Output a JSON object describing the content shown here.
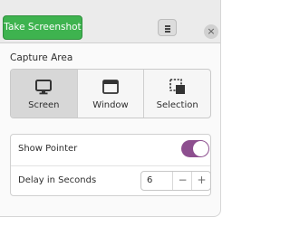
{
  "header": {
    "take_screenshot_label": "Take Screenshot",
    "menu_icon": "hamburger-menu-icon",
    "close_glyph": "×"
  },
  "capture_area": {
    "title": "Capture Area",
    "selected": "Screen",
    "options": [
      {
        "label": "Screen",
        "icon": "monitor-icon"
      },
      {
        "label": "Window",
        "icon": "window-icon"
      },
      {
        "label": "Selection",
        "icon": "selection-icon"
      }
    ]
  },
  "settings": {
    "show_pointer_label": "Show Pointer",
    "show_pointer_on": true,
    "delay_label": "Delay in Seconds",
    "delay_value": "6",
    "decrement_glyph": "−",
    "increment_glyph": "+"
  },
  "colors": {
    "accent_green": "#3eb34f",
    "toggle_purple": "#8d4f8f",
    "headerbar": "#ebebeb"
  }
}
